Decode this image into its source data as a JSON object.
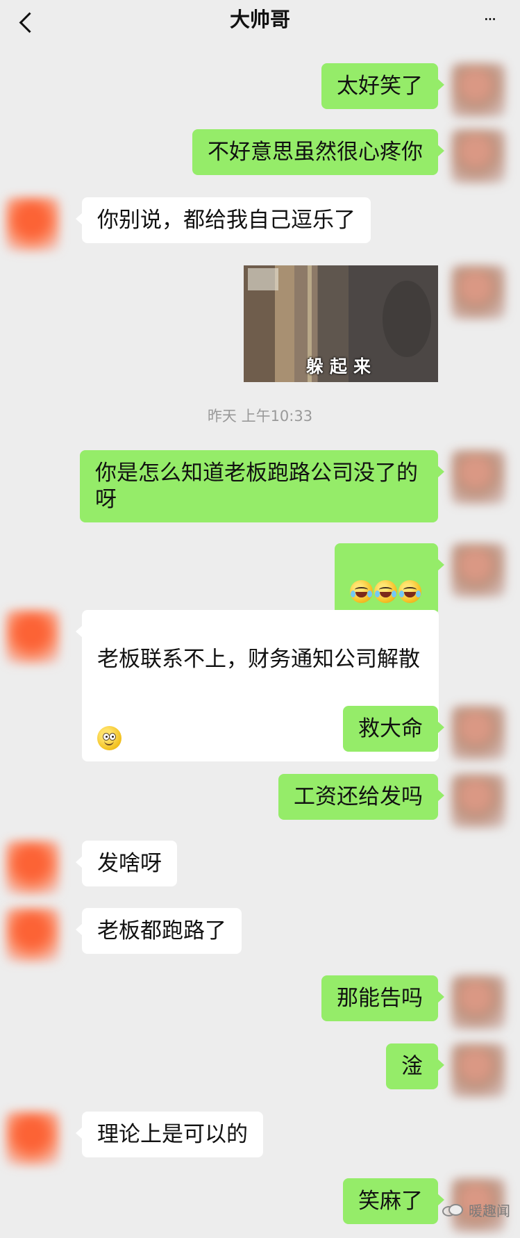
{
  "header": {
    "title": "大帅哥",
    "more_label": "···"
  },
  "messages": [
    {
      "from": "me",
      "text": "太好笑了"
    },
    {
      "from": "me",
      "text": "不好意思虽然很心疼你"
    },
    {
      "from": "friend",
      "text": "你别说，都给我自己逗乐了"
    },
    {
      "from": "me",
      "type": "image",
      "caption": "躲起来"
    },
    {
      "type": "timestamp",
      "text": "昨天 上午10:33"
    },
    {
      "from": "me",
      "text": "你是怎么知道老板跑路公司没了的\n呀"
    },
    {
      "from": "me",
      "type": "emoji",
      "emoji": "laugh-cry-emoji",
      "count": 3
    },
    {
      "from": "friend",
      "text": "老板联系不上，财务通知公司解散",
      "emoji": "smile-emoji"
    },
    {
      "from": "me",
      "text": "救大命"
    },
    {
      "from": "me",
      "text": "工资还给发吗"
    },
    {
      "from": "friend",
      "text": "发啥呀"
    },
    {
      "from": "friend",
      "text": "老板都跑路了"
    },
    {
      "from": "me",
      "text": "那能告吗"
    },
    {
      "from": "me",
      "text": "淦"
    },
    {
      "from": "friend",
      "text": "理论上是可以的"
    },
    {
      "from": "me",
      "text": "笑麻了"
    }
  ],
  "watermark": {
    "text": "暖趣闻",
    "icon": "wechat-icon"
  },
  "colors": {
    "background": "#ededed",
    "my_bubble": "#95ec69",
    "friend_bubble": "#ffffff",
    "timestamp": "#999999"
  }
}
